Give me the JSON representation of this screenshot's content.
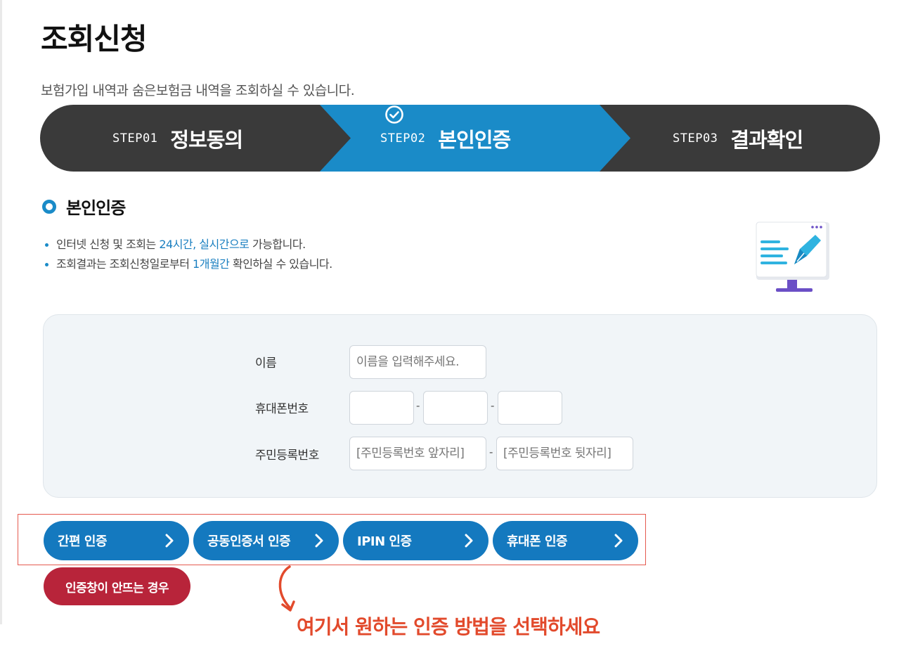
{
  "page": {
    "title": "조회신청",
    "description": "보험가입 내역과 숨은보험금 내역을 조회하실 수 있습니다."
  },
  "steps": [
    {
      "num": "STEP01",
      "name": "정보동의",
      "active": false
    },
    {
      "num": "STEP02",
      "name": "본인인증",
      "active": true
    },
    {
      "num": "STEP03",
      "name": "결과확인",
      "active": false
    }
  ],
  "section": {
    "title": "본인인증",
    "notes": [
      {
        "pre": "인터넷 신청 및 조회는 ",
        "hl": "24시간, 실시간으로",
        "post": " 가능합니다."
      },
      {
        "pre": "조회결과는 조회신청일로부터 ",
        "hl": "1개월간",
        "post": " 확인하실 수 있습니다."
      }
    ]
  },
  "form": {
    "name_label": "이름",
    "name_placeholder": "이름을 입력해주세요.",
    "phone_label": "휴대폰번호",
    "phone_sep": "-",
    "rrn_label": "주민등록번호",
    "rrn_front_placeholder": "[주민등록번호 앞자리]",
    "rrn_back_placeholder": "[주민등록번호 뒷자리]",
    "rrn_sep": "-"
  },
  "auth_buttons": [
    "간편 인증",
    "공동인증서 인증",
    "IPIN 인증",
    "휴대폰 인증"
  ],
  "fail_button": "인증창이 안뜨는 경우",
  "annotation": "여기서 원하는 인증 방법을 선택하세요",
  "colors": {
    "step_dark": "#3a3a3a",
    "step_active": "#1a8bc8",
    "auth_button": "#1479bf",
    "fail_button": "#b8243a",
    "annotation": "#e24a2c"
  },
  "icons": {
    "step_check": "check-circle-icon",
    "section_marker": "ring-icon",
    "illustration": "monitor-pen-icon",
    "button_arrow": "chevron-right-icon",
    "annotation_arrow": "curved-arrow-icon"
  }
}
